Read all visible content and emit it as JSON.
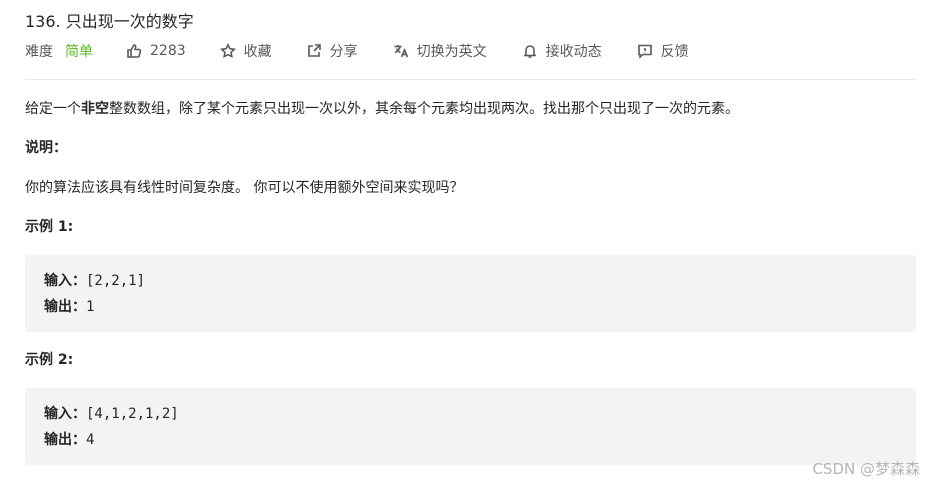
{
  "problem": {
    "title": "136. 只出现一次的数字"
  },
  "meta": {
    "difficulty_label": "难度",
    "difficulty_value": "简单",
    "difficulty_color": "#5ab726",
    "likes": "2283",
    "favorite_label": "收藏",
    "share_label": "分享",
    "switch_lang_label": "切换为英文",
    "notify_label": "接收动态",
    "feedback_label": "反馈",
    "icons": [
      "thumbs-up-icon",
      "star-icon",
      "share-icon",
      "translate-icon",
      "bell-icon",
      "feedback-icon"
    ]
  },
  "description": {
    "p1_a": "给定一个",
    "p1_b": "非空",
    "p1_c": "整数数组，除了某个元素只出现一次以外，其余每个元素均出现两次。找出那个只出现了一次的元素。",
    "note_heading": "说明：",
    "note_text": "你的算法应该具有线性时间复杂度。 你可以不使用额外空间来实现吗？"
  },
  "examples": [
    {
      "heading": "示例 1:",
      "input_label": "输入：",
      "input_value": "[2,2,1]",
      "output_label": "输出：",
      "output_value": "1"
    },
    {
      "heading": "示例 2:",
      "input_label": "输入：",
      "input_value": "[4,1,2,1,2]",
      "output_label": "输出：",
      "output_value": "4"
    }
  ],
  "watermark": "CSDN @梦森森"
}
